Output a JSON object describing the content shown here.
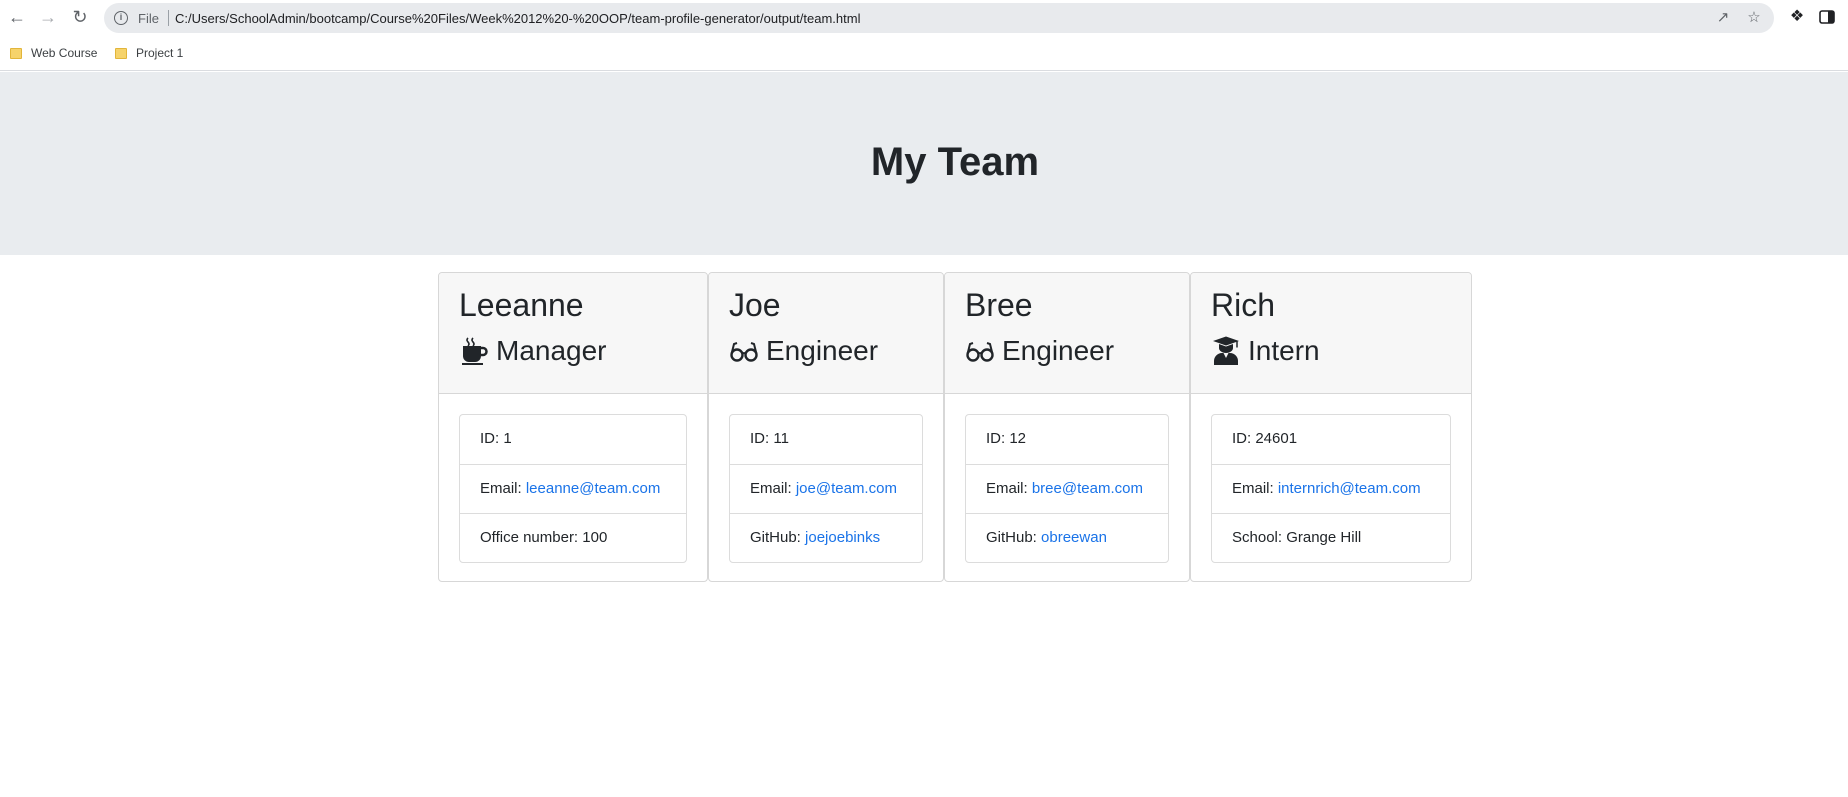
{
  "browser": {
    "omnibox_label": "File",
    "url": "C:/Users/SchoolAdmin/bootcamp/Course%20Files/Week%2012%20-%20OOP/team-profile-generator/output/team.html",
    "bookmarks": [
      "Web Course",
      "Project 1"
    ]
  },
  "page": {
    "title": "My Team"
  },
  "team": [
    {
      "name": "Leeanne",
      "role": "Manager",
      "icon": "coffee-icon",
      "id_text": "ID: 1",
      "email_label": "Email: ",
      "email": "leeanne@team.com",
      "extra_label": "Office number: 100",
      "extra_value": ""
    },
    {
      "name": "Joe",
      "role": "Engineer",
      "icon": "glasses-icon",
      "id_text": "ID: 11",
      "email_label": "Email: ",
      "email": "joe@team.com",
      "extra_label": "GitHub: ",
      "extra_value": "joejoebinks"
    },
    {
      "name": "Bree",
      "role": "Engineer",
      "icon": "glasses-icon",
      "id_text": "ID: 12",
      "email_label": "Email: ",
      "email": "bree@team.com",
      "extra_label": "GitHub: ",
      "extra_value": "obreewan"
    },
    {
      "name": "Rich",
      "role": "Intern",
      "icon": "graduate-icon",
      "id_text": "ID: 24601",
      "email_label": "Email: ",
      "email": "internrich@team.com",
      "extra_label": "School: Grange Hill",
      "extra_value": ""
    }
  ],
  "colors": {
    "link": "#1a73e8",
    "jumbotron": "#e9ecef",
    "card_header": "#f7f7f7"
  }
}
